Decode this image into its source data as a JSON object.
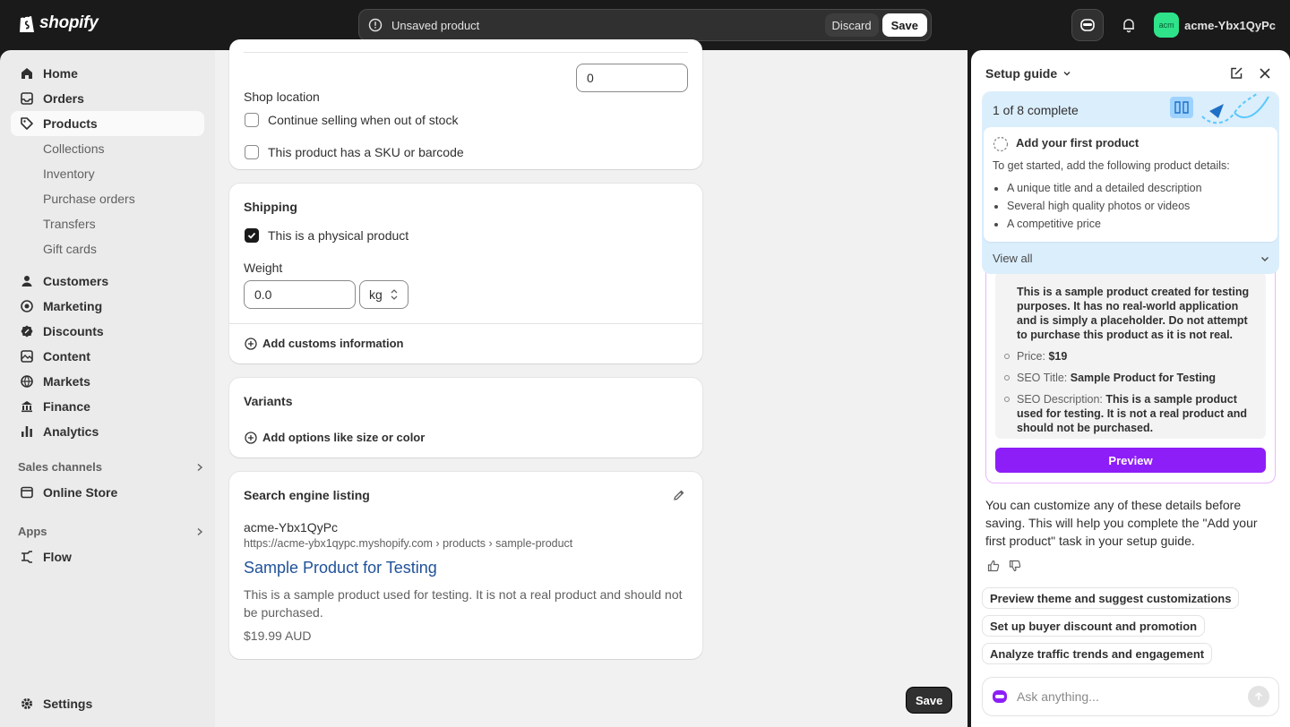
{
  "topbar": {
    "logo_text": "shopify",
    "unsaved_text": "Unsaved product",
    "discard_label": "Discard",
    "save_label": "Save",
    "store_avatar": "acm",
    "store_name": "acme-Ybx1QyPc",
    "brand_color": "#2ee38a"
  },
  "sidebar": {
    "home": "Home",
    "orders": "Orders",
    "products": "Products",
    "collections": "Collections",
    "inventory": "Inventory",
    "purchase_orders": "Purchase orders",
    "transfers": "Transfers",
    "gift_cards": "Gift cards",
    "customers": "Customers",
    "marketing": "Marketing",
    "discounts": "Discounts",
    "content": "Content",
    "markets": "Markets",
    "finance": "Finance",
    "analytics": "Analytics",
    "sales_channels": "Sales channels",
    "online_store": "Online Store",
    "apps": "Apps",
    "flow": "Flow",
    "settings": "Settings"
  },
  "inventory_card": {
    "shop_location_label": "Shop location",
    "shop_location_value": "0",
    "continue_selling_label": "Continue selling when out of stock",
    "continue_selling_checked": false,
    "sku_label": "This product has a SKU or barcode",
    "sku_checked": false
  },
  "shipping_card": {
    "title": "Shipping",
    "physical_label": "This is a physical product",
    "physical_checked": true,
    "weight_label": "Weight",
    "weight_value": "0.0",
    "weight_unit": "kg",
    "customs_label": "Add customs information"
  },
  "variants_card": {
    "title": "Variants",
    "add_options_label": "Add options like size or color"
  },
  "seo_card": {
    "title": "Search engine listing",
    "store_name": "acme-Ybx1QyPc",
    "url": "https://acme-ybx1qypc.myshopify.com › products › sample-product",
    "page_title": "Sample Product for Testing",
    "description": "This is a sample product used for testing. It is not a real product and should not be purchased.",
    "price": "$19.99 AUD"
  },
  "bottom_save_label": "Save",
  "setup_panel": {
    "title": "Setup guide",
    "progress_text": "1 of 8 complete",
    "task_title": "Add your first product",
    "task_desc": "To get started, add the following product details:",
    "task_bullets": [
      "A unique title and a detailed description",
      "Several high quality photos or videos",
      "A competitive price"
    ],
    "view_all": "View all",
    "preview_description": "This is a sample product created for testing purposes. It has no real-world application and is simply a placeholder. Do not attempt to purchase this product as it is not real.",
    "price_label": "Price:",
    "price_value": "$19",
    "seo_title_label": "SEO Title:",
    "seo_title_value": "Sample Product for Testing",
    "seo_desc_label": "SEO Description:",
    "seo_desc_value": "This is a sample product used for testing. It is not a real product and should not be purchased.",
    "preview_button": "Preview",
    "message": "You can customize any of these details before saving. This will help you complete the \"Add your first product\" task in your setup guide.",
    "chips": [
      "Preview theme and suggest customizations",
      "Set up buyer discount and promotion",
      "Analyze traffic trends and engagement"
    ],
    "ask_placeholder": "Ask anything...",
    "accent_color": "#8d1ef7"
  }
}
